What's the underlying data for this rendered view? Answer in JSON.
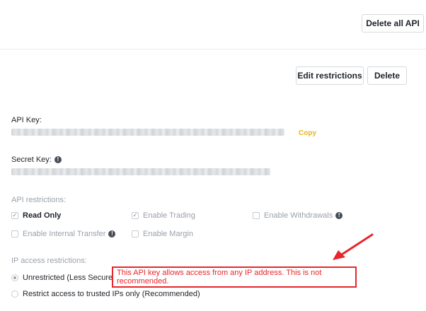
{
  "header": {
    "delete_all_label": "Delete all API"
  },
  "api_card": {
    "edit_label": "Edit restrictions",
    "delete_label": "Delete",
    "api_key_label": "API Key:",
    "copy_label": "Copy",
    "secret_key_label": "Secret Key:",
    "restrictions_title": "API restrictions:",
    "restrictions": [
      {
        "label": "Read Only",
        "checked": true,
        "enabled": true
      },
      {
        "label": "Enable Trading",
        "checked": true,
        "enabled": false
      },
      {
        "label": "Enable Withdrawals",
        "checked": false,
        "enabled": false
      },
      {
        "label": "Enable Internal Transfer",
        "checked": false,
        "enabled": false
      },
      {
        "label": "Enable Margin",
        "checked": false,
        "enabled": false
      }
    ],
    "ip_title": "IP access restrictions:",
    "ip_options": [
      {
        "label": "Unrestricted (Less Secure)",
        "selected": true
      },
      {
        "label": "Restrict access to trusted IPs only (Recommended)",
        "selected": false
      }
    ],
    "warning_text": "This API key allows access from any IP address. This is not recommended."
  },
  "colors": {
    "accent_copy": "#e6b41e",
    "warning_red": "#e8262b",
    "muted_text": "#9aa1a9"
  }
}
